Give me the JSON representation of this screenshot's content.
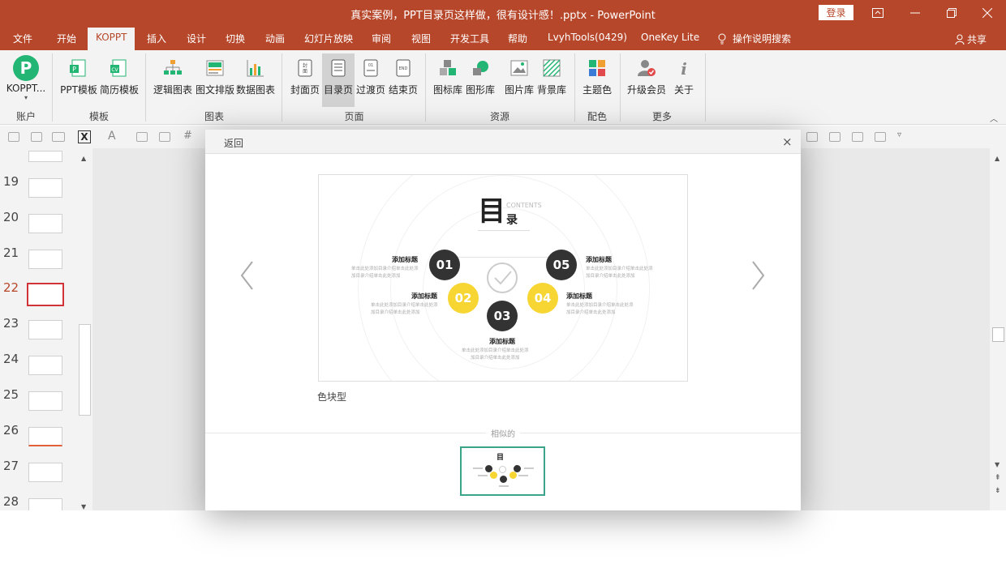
{
  "titlebar": {
    "title": "真实案例，PPT目录页这样做，很有设计感！.pptx  -  PowerPoint",
    "login": "登录"
  },
  "tabs": [
    "文件",
    "开始",
    "KOPPT",
    "插入",
    "设计",
    "切换",
    "动画",
    "幻灯片放映",
    "审阅",
    "视图",
    "开发工具",
    "帮助",
    "LvyhTools(0429)",
    "OneKey Lite",
    "操作说明搜索"
  ],
  "share": "共享",
  "ribbon": {
    "account": {
      "label": "KOPPT...",
      "group": "账户"
    },
    "template": {
      "items": [
        "PPT模板",
        "简历模板"
      ],
      "group": "模板"
    },
    "chart": {
      "items": [
        "逻辑图表",
        "图文排版",
        "数据图表"
      ],
      "group": "图表"
    },
    "page": {
      "items": [
        "封面页",
        "目录页",
        "过渡页",
        "结束页"
      ],
      "group": "页面"
    },
    "resource": {
      "items": [
        "图标库",
        "图形库",
        "图片库",
        "背景库"
      ],
      "group": "资源"
    },
    "color": {
      "items": [
        "主题色"
      ],
      "group": "配色"
    },
    "more": {
      "items": [
        "升级会员",
        "关于"
      ],
      "group": "更多"
    }
  },
  "slides": [
    "19",
    "20",
    "21",
    "22",
    "23",
    "24",
    "25",
    "26",
    "27",
    "28"
  ],
  "current_slide": "22",
  "dialog": {
    "back": "返回",
    "close": "×",
    "template_name": "色块型",
    "similar": "相似的",
    "preview": {
      "title_char": "目",
      "title_char2": "录",
      "contents": "CONTENTS",
      "items": [
        {
          "num": "01",
          "title": "添加标题",
          "desc": "单击此处添加目录介绍单击此处添\n加目录介绍单击此处添加"
        },
        {
          "num": "02",
          "title": "添加标题",
          "desc": "单击此处添加目录介绍单击此处添\n加目录介绍单击此处添加"
        },
        {
          "num": "03",
          "title": "添加标题",
          "desc": "单击此处添加目录介绍单击此处添\n加目录介绍单击此处添加"
        },
        {
          "num": "04",
          "title": "添加标题",
          "desc": "单击此处添加目录介绍单击此处添\n加目录介绍单击此处添加"
        },
        {
          "num": "05",
          "title": "添加标题",
          "desc": "单击此处添加目录介绍单击此处添\n加目录介绍单击此处添加"
        }
      ]
    }
  },
  "colors": {
    "brand": "#b7472a",
    "dark": "#333333",
    "yellow": "#f7d532",
    "accent": "#3aa58a"
  }
}
